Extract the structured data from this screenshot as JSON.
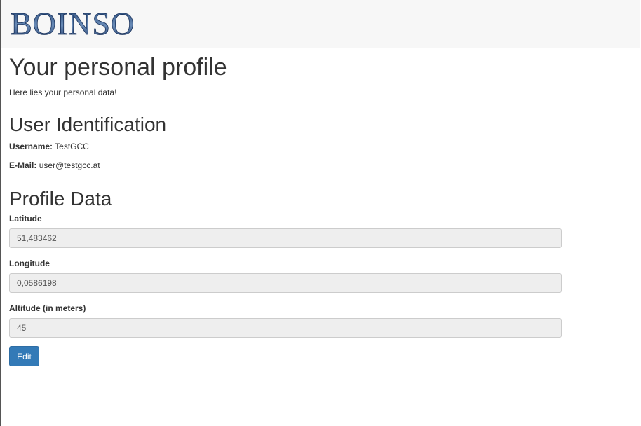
{
  "brand": {
    "logo_text": "BOINSO"
  },
  "page": {
    "title": "Your personal profile",
    "lead": "Here lies your personal data!"
  },
  "identification": {
    "heading": "User Identification",
    "username_label": "Username:",
    "username_value": "TestGCC",
    "email_label": "E-Mail:",
    "email_value": "user@testgcc.at"
  },
  "profile": {
    "heading": "Profile Data",
    "latitude_label": "Latitude",
    "latitude_value": "51,483462",
    "longitude_label": "Longitude",
    "longitude_value": "0,0586198",
    "altitude_label": "Altitude (in meters)",
    "altitude_value": "45",
    "edit_label": "Edit"
  },
  "colors": {
    "primary": "#337ab7",
    "navbar_bg": "#f7f7f7",
    "input_disabled_bg": "#eeeeee",
    "logo_blue": "#2a4a7a"
  }
}
